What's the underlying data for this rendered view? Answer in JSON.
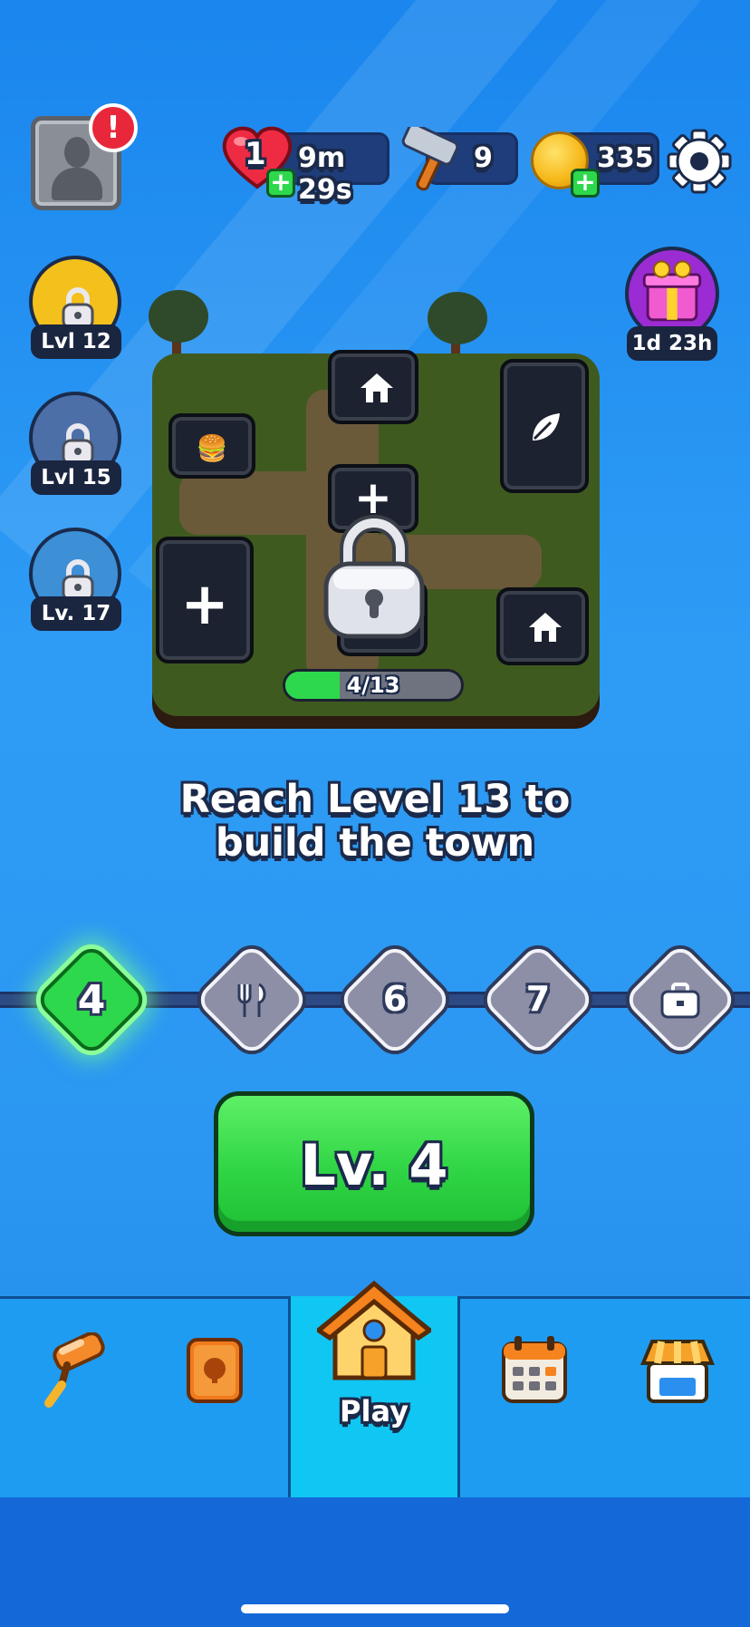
{
  "hud": {
    "lives": "1",
    "lives_timer": "9m 29s",
    "hammers": "9",
    "coins": "335",
    "alert": "!"
  },
  "side_events": [
    {
      "label": "Lvl 12",
      "icon": "locked-event-icon"
    },
    {
      "label": "Lvl 15",
      "icon": "locked-event-icon"
    },
    {
      "label": "Lv. 17",
      "icon": "locked-event-icon"
    }
  ],
  "gift_timer": "1d 23h",
  "town": {
    "progress_text": "4/13",
    "progress_fraction": 0.31,
    "message_line1": "Reach Level 13 to",
    "message_line2": "build the town"
  },
  "level_track": {
    "current": "4",
    "nodes": [
      "6",
      "7"
    ]
  },
  "play_button": {
    "label": "Lv. 4"
  },
  "nav": {
    "play_label": "Play",
    "items": [
      "paint-roller-icon",
      "collection-book-icon",
      "home-icon",
      "calendar-icon",
      "shop-icon"
    ]
  },
  "colors": {
    "accent_green": "#2ed84c",
    "background_blue": "#2b97f2",
    "dark_outline": "#1b2a4a"
  }
}
